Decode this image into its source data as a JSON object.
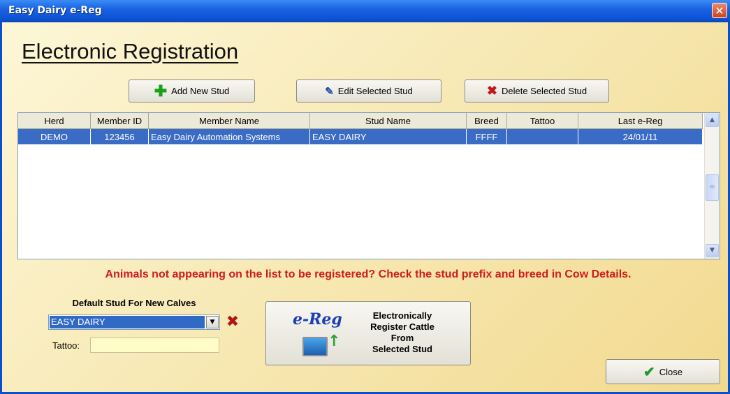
{
  "window": {
    "title": "Easy Dairy e-Reg",
    "close_glyph": "✕"
  },
  "heading": "Electronic Registration",
  "toolbar": {
    "add_icon": "plus-icon",
    "add_label": "Add New Stud",
    "edit_icon": "edit-icon",
    "edit_label": "Edit Selected Stud",
    "delete_icon": "delete-x-icon",
    "delete_label": "Delete Selected Stud"
  },
  "table": {
    "columns": [
      "Herd",
      "Member ID",
      "Member Name",
      "Stud Name",
      "Breed",
      "Tattoo",
      "Last e-Reg"
    ],
    "rows": [
      [
        "DEMO",
        "123456",
        "Easy Dairy Automation Systems",
        "EASY DAIRY",
        "FFFF",
        "",
        "24/01/11"
      ]
    ]
  },
  "warning": "Animals not appearing on the list to be registered? Check the stud prefix and breed in Cow Details.",
  "default_stud": {
    "label": "Default Stud For New Calves",
    "selected": "EASY DAIRY",
    "tattoo_label": "Tattoo:",
    "tattoo_value": ""
  },
  "ereg_button": {
    "logo": "e-Reg",
    "line1": "Electronically",
    "line2": "Register Cattle",
    "line3": "From",
    "line4": "Selected Stud"
  },
  "close_button": {
    "label": "Close"
  },
  "colors": {
    "titlebar": "#0d55d8",
    "selection": "#3a6bc5",
    "warning": "#d21a1a",
    "background": "#f6e6ad"
  }
}
